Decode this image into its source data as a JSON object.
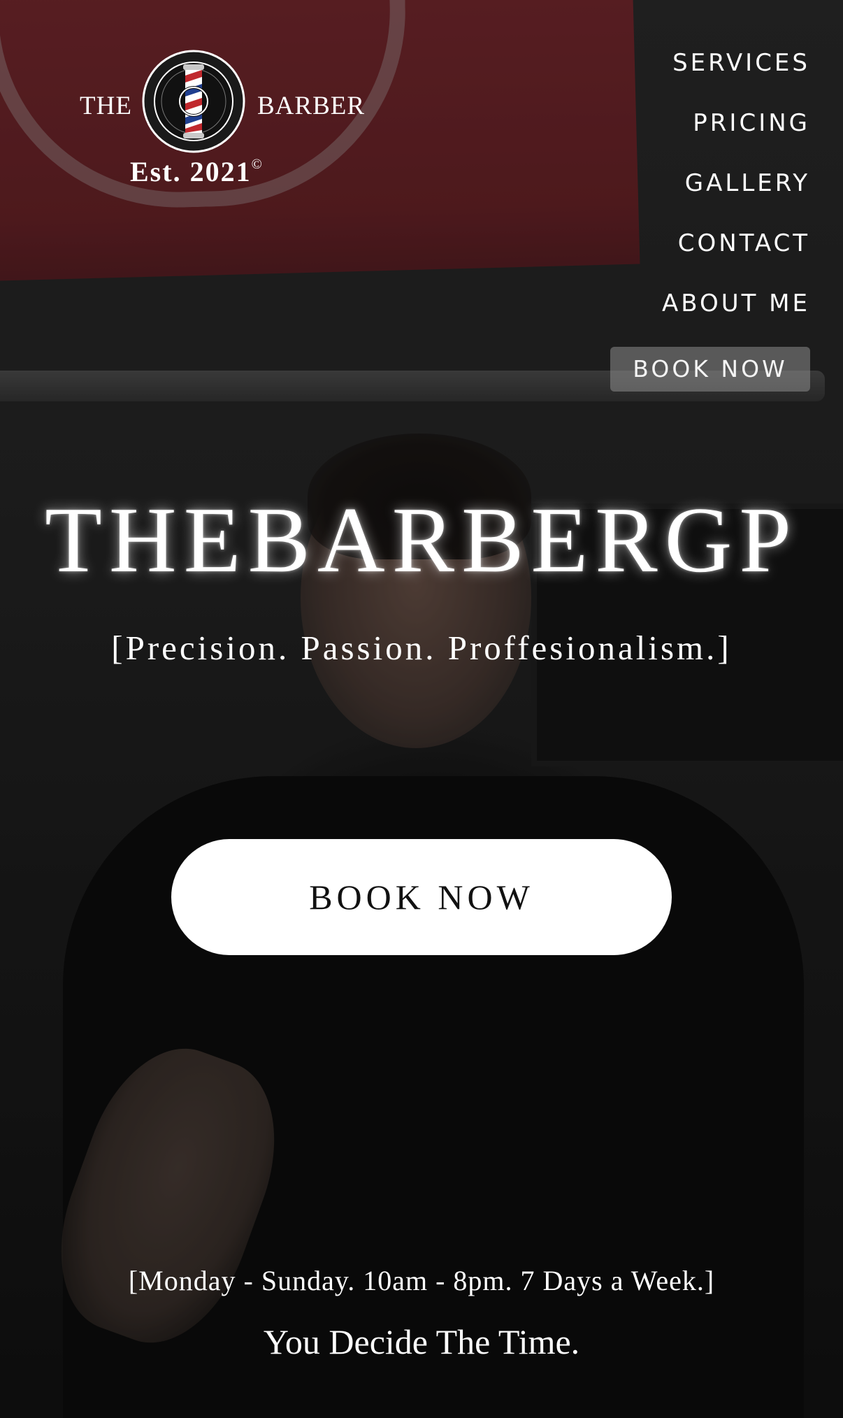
{
  "brand": {
    "left_word": "THE",
    "right_word": "BARBER",
    "est": "Est. 2021",
    "copyright": "©"
  },
  "nav": {
    "items": [
      {
        "label": "SERVICES"
      },
      {
        "label": "PRICING"
      },
      {
        "label": "GALLERY"
      },
      {
        "label": "CONTACT"
      },
      {
        "label": "ABOUT ME"
      }
    ],
    "book_label": "BOOK NOW"
  },
  "hero": {
    "title": "THEBARBERGP",
    "tagline": "[Precision. Passion. Proffesionalism.]",
    "cta_label": "BOOK NOW",
    "hours": "[Monday - Sunday. 10am - 8pm. 7 Days a Week.]",
    "time_line": "You Decide The Time."
  },
  "colors": {
    "text": "#ffffff",
    "cta_bg": "#ffffff",
    "cta_text": "#111111",
    "nav_book_bg": "#8c8c8c"
  }
}
